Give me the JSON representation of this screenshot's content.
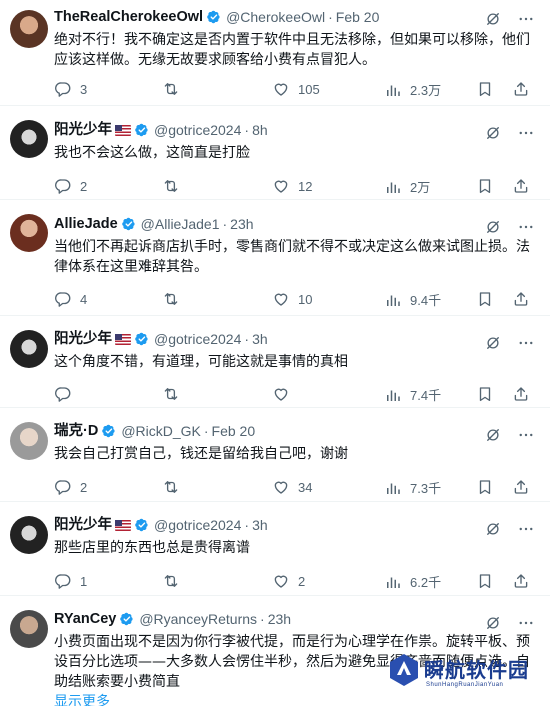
{
  "tweets": [
    {
      "name": "TheRealCherokeeOwl",
      "handle": "@CherokeeOwl",
      "dot": "·",
      "time": "Feb 20",
      "text": "绝对不行！我不确定这是否内置于软件中且无法移除，但如果可以移除，他们应该这样做。无缘无故要求顾客给小费有点冒犯人。",
      "replies": "3",
      "retweets": "",
      "likes": "105",
      "views": "2.3万"
    },
    {
      "name": "阳光少年",
      "handle": "@gotrice2024",
      "dot": "·",
      "time": "8h",
      "text": "我也不会这么做，这简直是打脸",
      "replies": "2",
      "retweets": "",
      "likes": "12",
      "views": "2万"
    },
    {
      "name": "AllieJade",
      "handle": "@AllieJade1",
      "dot": "·",
      "time": "23h",
      "text": "当他们不再起诉商店扒手时，零售商们就不得不或决定这么做来试图止损。法律体系在这里难辞其咎。",
      "replies": "4",
      "retweets": "",
      "likes": "10",
      "views": "9.4千"
    },
    {
      "name": "阳光少年",
      "handle": "@gotrice2024",
      "dot": "·",
      "time": "3h",
      "text": "这个角度不错，有道理，可能这就是事情的真相",
      "replies": "",
      "retweets": "",
      "likes": "",
      "views": "7.4千"
    },
    {
      "name": "瑞克·D",
      "handle": "@RickD_GK",
      "dot": "·",
      "time": "Feb 20",
      "text": "我会自己打赏自己，钱还是留给我自己吧，谢谢",
      "replies": "2",
      "retweets": "",
      "likes": "34",
      "views": "7.3千"
    },
    {
      "name": "阳光少年",
      "handle": "@gotrice2024",
      "dot": "·",
      "time": "3h",
      "text": "那些店里的东西也总是贵得离谱",
      "replies": "1",
      "retweets": "",
      "likes": "2",
      "views": "6.2千"
    },
    {
      "name": "RYanCey",
      "handle": "@RyanceyReturns",
      "dot": "·",
      "time": "23h",
      "text": "小费页面出现不是因为你行李被代提，而是行为心理学在作祟。旋转平板、预设百分比选项——大多数人会愣住半秒，然后为避免显得吝啬而随便点选。自助结账索要小费简直",
      "show_more": "显示更多"
    }
  ],
  "watermark": {
    "title": "瞬航软件园",
    "subtitle": "ShunHangRuanJianYuan"
  },
  "colors": {
    "text": "#0f1419",
    "secondary": "#536471",
    "link": "#1d9bf0",
    "verified": "#1d9bf0",
    "divider": "#eff3f4"
  }
}
